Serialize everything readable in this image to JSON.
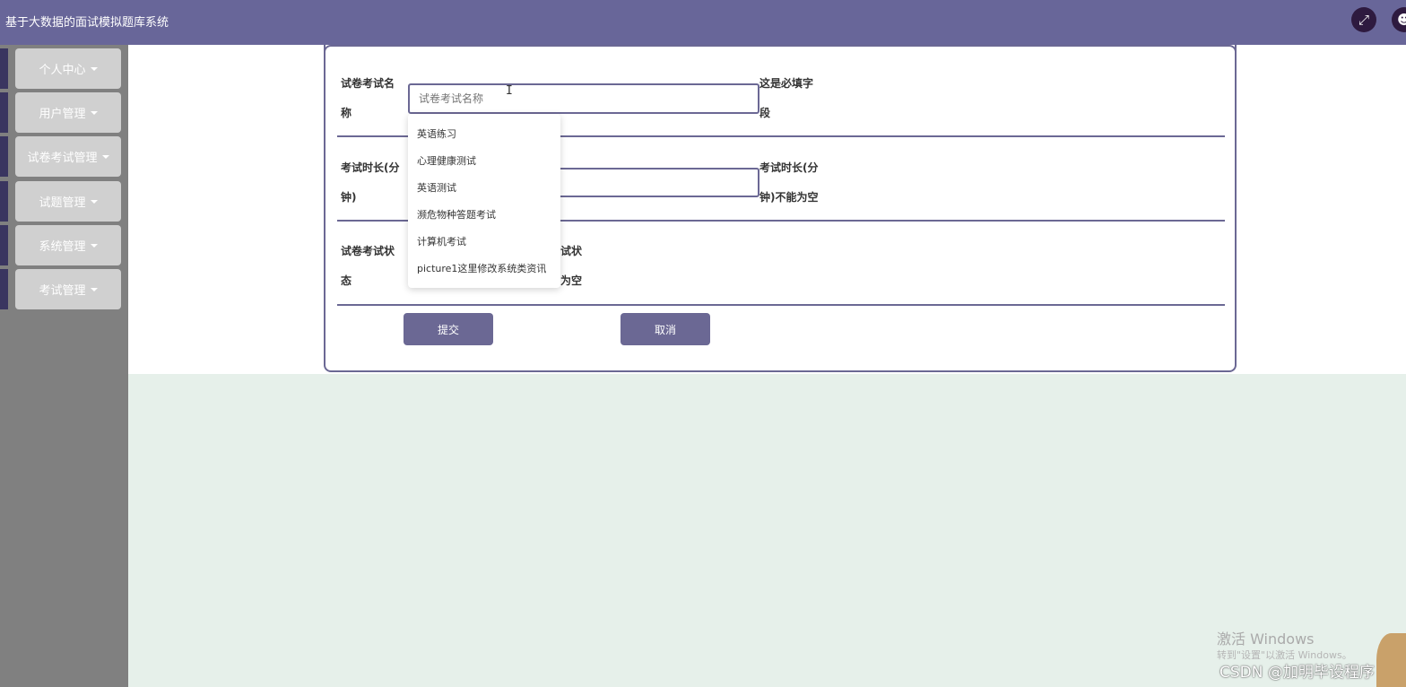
{
  "app": {
    "title": "基于大数据的面试模拟题库系统"
  },
  "header": {
    "fullscreen_icon": "expand-icon",
    "user_icon": "user-icon"
  },
  "sidebar": {
    "items": [
      {
        "label": "个人中心"
      },
      {
        "label": "用户管理"
      },
      {
        "label": "试卷考试管理"
      },
      {
        "label": "试题管理"
      },
      {
        "label": "系统管理"
      },
      {
        "label": "考试管理"
      }
    ]
  },
  "form": {
    "name_field": {
      "label_line1": "试卷考试名",
      "label_line2": "称",
      "placeholder": "试卷考试名称",
      "hint_line1": "这是必填字",
      "hint_line2": "段"
    },
    "duration_field": {
      "label_line1": "考试时长(分",
      "label_line2": "钟)",
      "value": "",
      "hint_line1": "考试时长(分",
      "hint_line2": "钟)不能为空"
    },
    "status_field": {
      "label_line1": "试卷考试状",
      "label_line2": "态",
      "hint_line1": "试状",
      "hint_line2": "为空"
    },
    "submit_label": "提交",
    "cancel_label": "取消"
  },
  "autocomplete": {
    "options": [
      "英语练习",
      "心理健康测试",
      "英语测试",
      "濒危物种答题考试",
      "计算机考试",
      "picture1这里修改系统类资讯"
    ]
  },
  "overlay": {
    "windows_activate": "激活 Windows",
    "windows_hint": "转到\"设置\"以激活 Windows。",
    "watermark": "CSDN @加明毕设程序"
  },
  "colors": {
    "accent": "#686699",
    "sidebar_bg": "#808080",
    "menu_button_bg": "#d0d0d0",
    "page_bg": "#e6f0ea"
  }
}
